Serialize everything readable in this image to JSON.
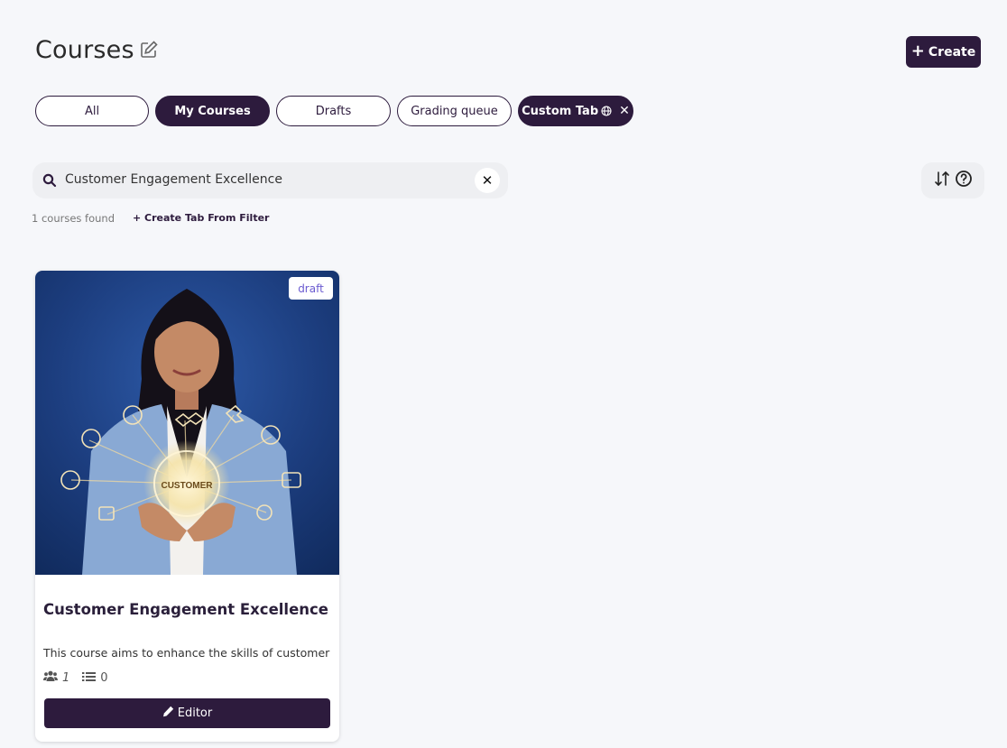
{
  "page": {
    "title": "Courses"
  },
  "header": {
    "create_label": "Create"
  },
  "tabs": [
    {
      "label": "All",
      "active": false
    },
    {
      "label": "My Courses",
      "active": true
    },
    {
      "label": "Drafts",
      "active": false
    },
    {
      "label": "Grading queue",
      "active": false
    },
    {
      "label": "Custom Tab",
      "active": true
    }
  ],
  "search": {
    "value": "Customer Engagement Excellence"
  },
  "results": {
    "found_text": "1 courses found",
    "create_tab_link": "+ Create Tab From Filter"
  },
  "courses": [
    {
      "title": "Customer Engagement Excellence",
      "description": "This course aims to enhance the skills of customer",
      "status": "draft",
      "image_caption": "CUSTOMER",
      "members": "1",
      "lessons": "0",
      "action_label": "Editor"
    }
  ],
  "colors": {
    "accent": "#2d1b3d",
    "badge_text": "#6a5ad0",
    "background": "#f6f7fa"
  },
  "icons": [
    "edit-icon",
    "plus-icon",
    "globe-icon",
    "close-icon",
    "search-icon",
    "sort-icon",
    "help-icon",
    "users-icon",
    "list-icon",
    "pencil-icon"
  ]
}
